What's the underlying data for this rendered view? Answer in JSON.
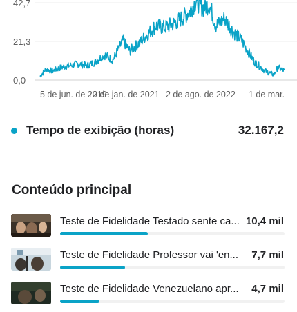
{
  "chart_data": {
    "type": "line",
    "y_ticks": [
      "42,7",
      "21,3",
      "0,0"
    ],
    "ylim": [
      0,
      42.7
    ],
    "x_ticks": [
      "5 de jun. de 2019",
      "12 de jan. de 2021",
      "2 de ago. de 2022",
      "1 de mar."
    ],
    "x": [
      "2019-06-05",
      "2019-07-15",
      "2019-09-01",
      "2019-11-01",
      "2020-01-01",
      "2020-03-01",
      "2020-05-01",
      "2020-07-01",
      "2020-09-01",
      "2020-11-01",
      "2021-01-12",
      "2021-03-01",
      "2021-05-01",
      "2021-07-01",
      "2021-09-01",
      "2021-11-01",
      "2022-01-01",
      "2022-03-01",
      "2022-05-01",
      "2022-06-15",
      "2022-08-02",
      "2022-09-15",
      "2022-11-01",
      "2023-01-01",
      "2023-03-01",
      "2023-05-01",
      "2023-06-15",
      "2023-08-01",
      "2023-09-15",
      "2023-10-15",
      "2023-11-15",
      "2023-12-15",
      "2024-01-15",
      "2024-03-01"
    ],
    "series": [
      {
        "values": [
          2,
          6,
          5,
          7,
          8,
          9,
          8,
          10,
          14,
          11,
          22,
          16,
          20,
          25,
          30,
          29,
          31,
          34,
          38,
          44,
          40,
          42,
          30,
          34,
          27,
          22,
          16,
          10,
          7,
          5,
          4,
          3,
          7,
          5
        ],
        "color": "#0aa3c7"
      }
    ],
    "grid": true
  },
  "metric": {
    "label": "Tempo de exibição (horas)",
    "value": "32.167,2",
    "dot_color": "#0aa3c7"
  },
  "section_title": "Conteúdo principal",
  "content_items": [
    {
      "title": "Teste de Fidelidade Testado sente ca...",
      "value": "10,4 mil",
      "share": 1.0,
      "thumb": "thumb-1"
    },
    {
      "title": "Teste de Fidelidade Professor vai 'en...",
      "value": "7,7 mil",
      "share": 0.74,
      "thumb": "thumb-2"
    },
    {
      "title": "Teste de Fidelidade Venezuelano apr...",
      "value": "4,7 mil",
      "share": 0.45,
      "thumb": "thumb-3"
    }
  ]
}
